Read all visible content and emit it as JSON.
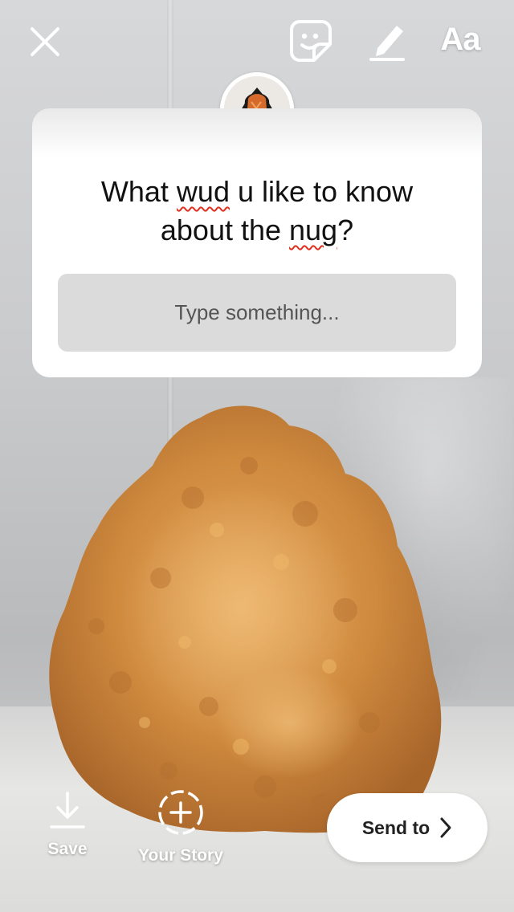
{
  "top_bar": {
    "close_icon": "close-icon",
    "sticker_icon": "sticker-face-icon",
    "draw_icon": "pen-icon",
    "text_tool_label": "Aa"
  },
  "question_sticker": {
    "question_line_1_pre": "What ",
    "question_line_1_flagged": "wud",
    "question_line_1_post": " u like to know",
    "question_line_2_pre": "about the ",
    "question_line_2_flagged": "nug",
    "question_line_2_post": "?",
    "answer_placeholder": "Type something..."
  },
  "bottom_bar": {
    "save_label": "Save",
    "your_story_label": "Your Story",
    "send_to_label": "Send to"
  },
  "colors": {
    "spellcheck_underline": "#e0301e",
    "answer_field_bg": "#dbdbdb",
    "card_bg": "#ffffff",
    "nugget_color": "#d08a3c"
  }
}
